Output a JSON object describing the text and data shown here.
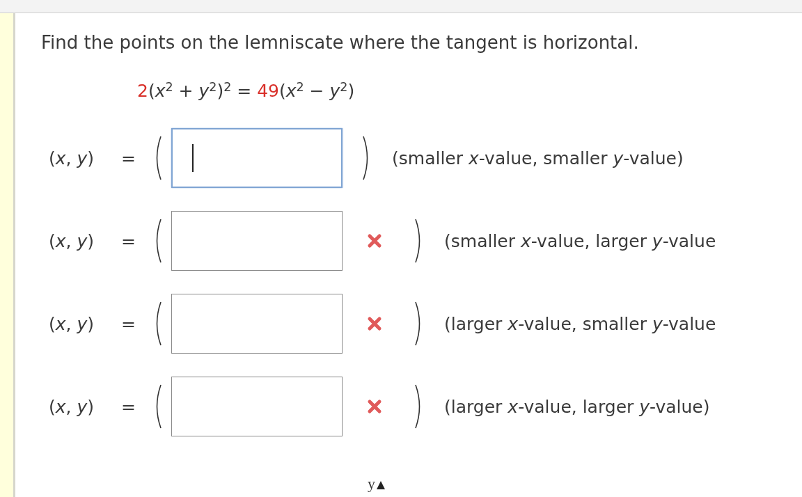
{
  "question": {
    "prompt": "Find the points on the lemniscate where the tangent is horizontal.",
    "equation": [
      {
        "text": "2",
        "highlighted": true
      },
      {
        "text": "(*x*$^{2}$ + *y*$^{2}$)$^{2}$ = ",
        "highlighted": false
      },
      {
        "text": "49",
        "highlighted": true
      },
      {
        "text": "(*x*$^{2}$ − *y*$^{2}$)",
        "highlighted": false
      }
    ]
  },
  "answers": [
    {
      "label": "(*x*, *y*)",
      "equals": "=",
      "focused": true,
      "incorrect": false,
      "hint": "(smaller *x*-value, smaller *y*-value)"
    },
    {
      "label": "(*x*, *y*)",
      "equals": "=",
      "focused": false,
      "incorrect": true,
      "hint": "(smaller *x*-value, larger *y*-value"
    },
    {
      "label": "(*x*, *y*)",
      "equals": "=",
      "focused": false,
      "incorrect": true,
      "hint": "(larger *x*-value, smaller *y*-value"
    },
    {
      "label": "(*x*, *y*)",
      "equals": "=",
      "focused": false,
      "incorrect": true,
      "hint": "(larger *x*-value, larger *y*-value)"
    }
  ],
  "graph": {
    "axis_label": "y"
  }
}
